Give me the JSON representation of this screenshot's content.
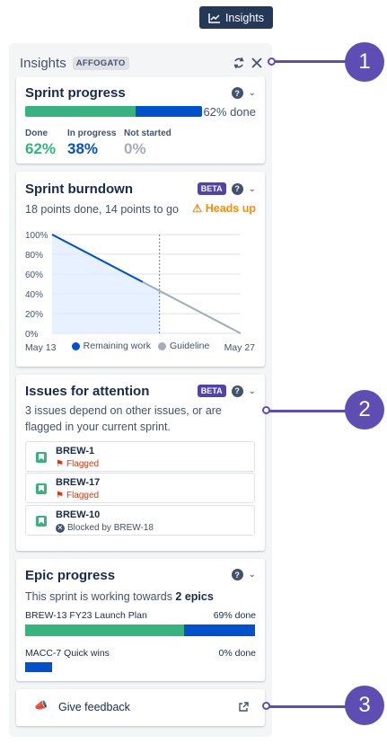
{
  "insights_button": {
    "label": "Insights",
    "icon": "trend-chart-icon"
  },
  "panel": {
    "title": "Insights",
    "tag": "AFFOGATO"
  },
  "sprint_progress": {
    "title": "Sprint progress",
    "done_pct_label": "62% done",
    "stats": [
      {
        "label": "Done",
        "value": "62%",
        "color": "#36b37e"
      },
      {
        "label": "In progress",
        "value": "38%",
        "color": "#0052cc"
      },
      {
        "label": "Not started",
        "value": "0%",
        "color": "#a5adba"
      }
    ],
    "done_fraction": 0.62
  },
  "burndown": {
    "title": "Sprint burndown",
    "badge": "BETA",
    "summary": "18 points done, 14 points to go",
    "warning": "⚠ Heads up",
    "legend_remaining": "Remaining work",
    "legend_guideline": "Guideline"
  },
  "chart_data": {
    "type": "line",
    "x": [
      "May 13",
      "May 27"
    ],
    "y_ticks": [
      "100%",
      "80%",
      "60%",
      "40%",
      "20%",
      "0%"
    ],
    "ylim": [
      0,
      100
    ],
    "series": [
      {
        "name": "Remaining work",
        "color": "#0052cc",
        "points": [
          [
            0,
            100
          ],
          [
            0.48,
            52
          ]
        ]
      },
      {
        "name": "Guideline",
        "color": "#a5adba",
        "points": [
          [
            0,
            100
          ],
          [
            1,
            0
          ]
        ]
      }
    ],
    "today_fraction": 0.57
  },
  "attention": {
    "title": "Issues for attention",
    "badge": "BETA",
    "description": "3 issues depend on other issues, or are flagged in your current sprint.",
    "issues": [
      {
        "key": "BREW-1",
        "status": "Flagged"
      },
      {
        "key": "BREW-17",
        "status": "Flagged"
      },
      {
        "key": "BREW-10",
        "status": "Blocked by BREW-18"
      }
    ]
  },
  "epics": {
    "title": "Epic progress",
    "summary_prefix": "This sprint is working towards ",
    "summary_bold": "2 epics",
    "items": [
      {
        "name": "BREW-13 FY23 Launch Plan",
        "pct_label": "69% done",
        "done": 0.69
      },
      {
        "name": "MACC-7 Quick wins",
        "pct_label": "0% done",
        "done": 0
      }
    ]
  },
  "feedback": {
    "label": "Give feedback"
  },
  "callouts": [
    "1",
    "2",
    "3"
  ],
  "colors": {
    "done": "#36b37e",
    "in_progress": "#0052cc",
    "callout": "#5e4db2"
  }
}
